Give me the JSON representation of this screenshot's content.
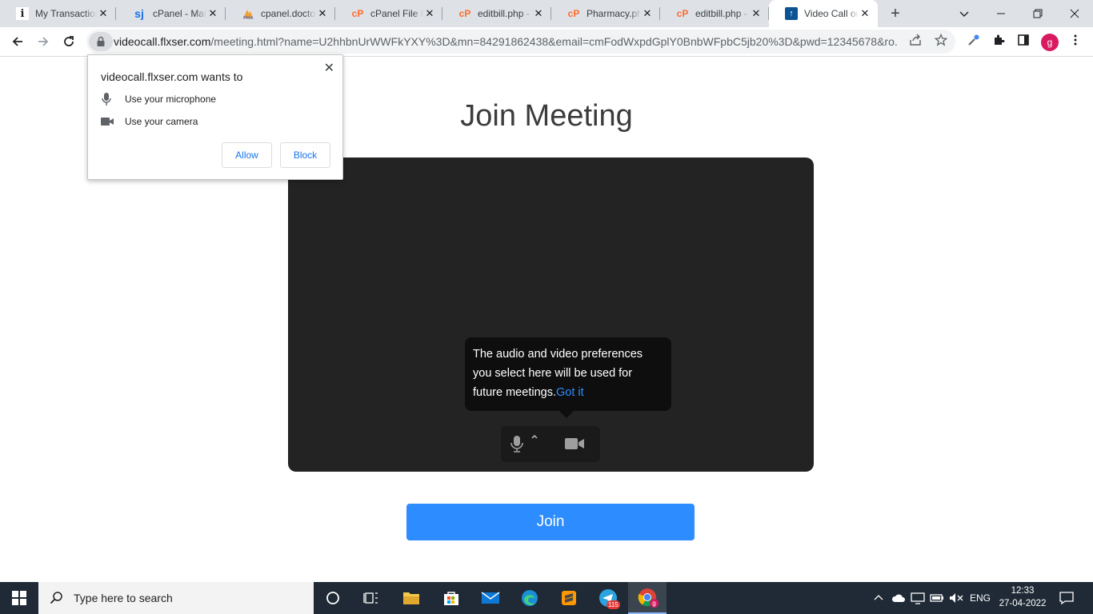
{
  "browser": {
    "tabs": [
      {
        "title": "My Transactions",
        "icon": "info-icon"
      },
      {
        "title": "cPanel - Main",
        "icon": "sj-icon"
      },
      {
        "title": "cpanel.doctors",
        "icon": "phpmyadmin-icon"
      },
      {
        "title": "cPanel File Manager",
        "icon": "cpanel-icon"
      },
      {
        "title": "editbill.php -",
        "icon": "cpanel-icon"
      },
      {
        "title": "Pharmacy.php",
        "icon": "cpanel-icon"
      },
      {
        "title": "editbill.php -",
        "icon": "cpanel-icon"
      },
      {
        "title": "Video Call on",
        "icon": "upload-icon"
      }
    ],
    "url_host": "videocall.flxser.com",
    "url_rest": "/meeting.html?name=U2hhbnUrWWFkYXY%3D&mn=84291862438&email=cmFodWxpdGplY0BnbWFpbC5jb20%3D&pwd=12345678&ro...",
    "profile_initial": "g"
  },
  "permission": {
    "title": "videocall.flxser.com wants to",
    "microphone": "Use your microphone",
    "camera": "Use your camera",
    "allow": "Allow",
    "block": "Block"
  },
  "page": {
    "heading": "Join Meeting",
    "tooltip_text": "The audio and video preferences you select here will be used for future meetings.",
    "tooltip_link": "Got it",
    "join_label": "Join"
  },
  "taskbar": {
    "search_placeholder": "Type here to search",
    "telegram_badge": "115",
    "language": "ENG",
    "time": "12:33",
    "date": "27-04-2022"
  }
}
